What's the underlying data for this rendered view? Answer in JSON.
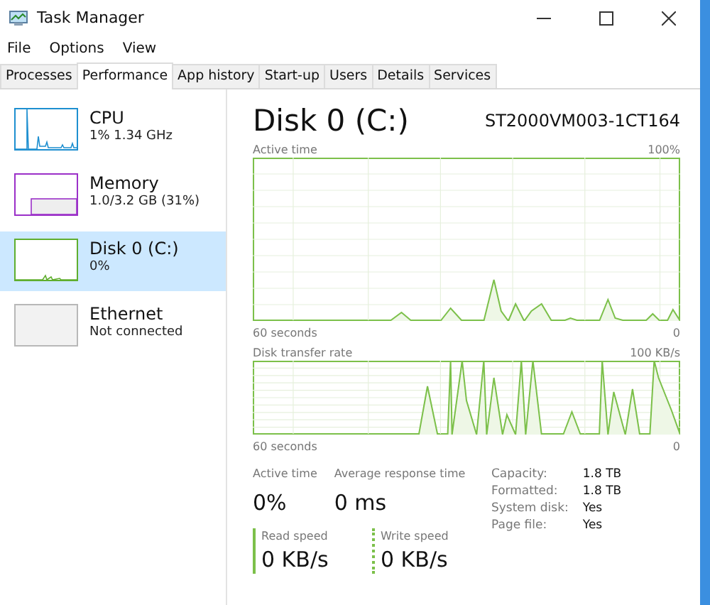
{
  "window": {
    "title": "Task Manager"
  },
  "menu": [
    "File",
    "Options",
    "View"
  ],
  "tabs": [
    {
      "label": "Processes",
      "selected": false
    },
    {
      "label": "Performance",
      "selected": true
    },
    {
      "label": "App history",
      "selected": false
    },
    {
      "label": "Start-up",
      "selected": false
    },
    {
      "label": "Users",
      "selected": false
    },
    {
      "label": "Details",
      "selected": false
    },
    {
      "label": "Services",
      "selected": false
    }
  ],
  "sidebar": {
    "items": [
      {
        "name": "CPU",
        "detail": "1% 1.34 GHz",
        "color": "#1e8fd0",
        "selected": false
      },
      {
        "name": "Memory",
        "detail": "1.0/3.2 GB (31%)",
        "color": "#9b30c8",
        "selected": false
      },
      {
        "name": "Disk 0 (C:)",
        "detail": "0%",
        "color": "#5fae2e",
        "selected": true
      },
      {
        "name": "Ethernet",
        "detail": "Not connected",
        "color": "#b8b8b8",
        "selected": false
      }
    ]
  },
  "detail": {
    "title": "Disk 0 (C:)",
    "model": "ST2000VM003-1CT164",
    "charts": [
      {
        "label": "Active time",
        "max": "100%",
        "time": "60 seconds",
        "min": "0"
      },
      {
        "label": "Disk transfer rate",
        "max": "100 KB/s",
        "time": "60 seconds",
        "min": "0"
      }
    ],
    "stats": [
      {
        "label": "Active time",
        "value": "0%"
      },
      {
        "label": "Average response time",
        "value": "0 ms"
      }
    ],
    "speeds": [
      {
        "label": "Read speed",
        "value": "0 KB/s",
        "kind": "solid"
      },
      {
        "label": "Write speed",
        "value": "0 KB/s",
        "kind": "dotted"
      }
    ],
    "properties": [
      {
        "label": "Capacity:",
        "value": "1.8 TB"
      },
      {
        "label": "Formatted:",
        "value": "1.8 TB"
      },
      {
        "label": "System disk:",
        "value": "Yes"
      },
      {
        "label": "Page file:",
        "value": "Yes"
      }
    ]
  }
}
